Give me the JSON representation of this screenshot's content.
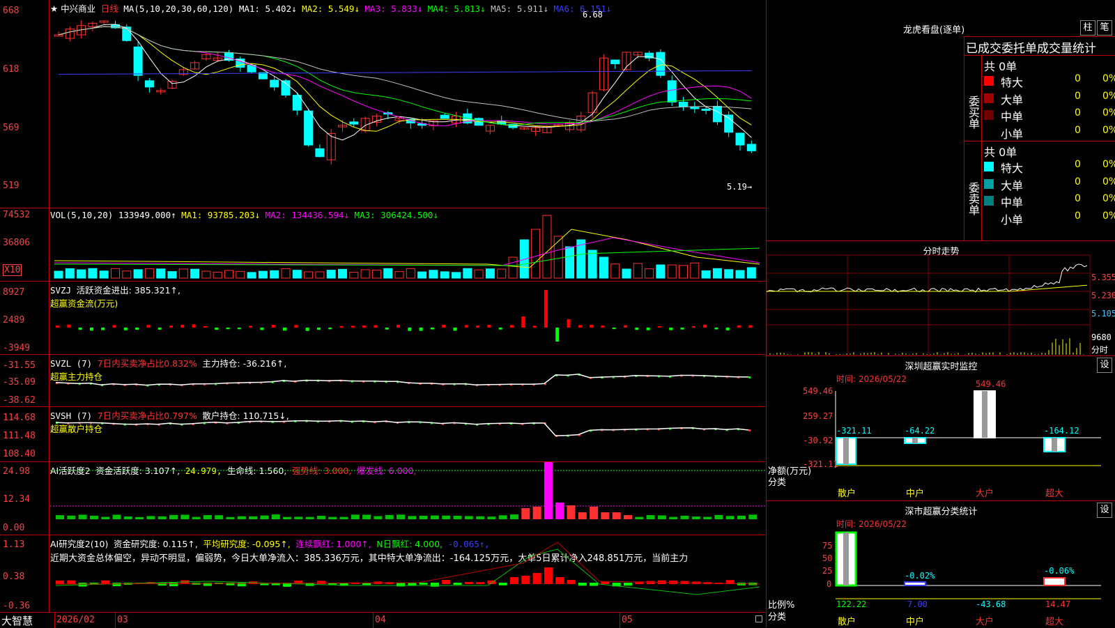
{
  "main_chart": {
    "stock_name": "★ 中兴商业",
    "period": "日线",
    "ma_params": "MA(5,10,20,30,60,120)",
    "ma_values": [
      {
        "label": "MA1: 5.402↓",
        "color": "#ffffff"
      },
      {
        "label": "MA2: 5.549↓",
        "color": "#ffff00"
      },
      {
        "label": "MA3: 5.833↓",
        "color": "#ff00ff"
      },
      {
        "label": "MA4: 5.813↓",
        "color": "#00ff00"
      },
      {
        "label": "MA5: 5.911↓",
        "color": "#c0c0c0"
      },
      {
        "label": "MA6: 6.151↓",
        "color": "#3c3cff"
      }
    ],
    "y_labels": [
      "668",
      "618",
      "569",
      "519"
    ],
    "high_marker": "6.68",
    "low_marker": "5.19→"
  },
  "volume": {
    "title": "VOL(5,10,20)",
    "value": "133949.000↑",
    "ma1": "MA1: 93785.203↓",
    "ma2": "MA2: 134436.594↓",
    "ma3": "MA3: 306424.500↓",
    "y_labels": [
      "74532",
      "36806"
    ],
    "unit": "X10"
  },
  "svzj": {
    "title": "SVZJ",
    "label": "活跃资金进出: 385.321↑,",
    "subtitle": "超赢资金流(万元)",
    "y_labels": [
      "8927",
      "2489",
      "-3949"
    ]
  },
  "svzl": {
    "title": "SVZL (7)",
    "label1": "7日内买卖净占比0.832%",
    "label2": "主力持仓: -36.216↑,",
    "subtitle": "超赢主力持仓",
    "y_labels": [
      "-31.55",
      "-35.09",
      "-38.62"
    ]
  },
  "svsh": {
    "title": "SVSH (7)",
    "label1": "7日内买卖净占比0.797%",
    "label2": "散户持仓: 110.715↓,",
    "subtitle": "超赢散户持仓",
    "y_labels": [
      "114.68",
      "111.48",
      "108.40"
    ]
  },
  "ai_active": {
    "title": "AI活跃度2",
    "v1": "资金活跃度: 3.107↑,",
    "v2": "24.979,",
    "v3": "生命线: 1.560,",
    "v4": "强势线: 3.000,",
    "v5": "爆发线: 6.000,",
    "y_labels": [
      "24.98",
      "12.34",
      "0.00"
    ]
  },
  "ai_research": {
    "title": "AI研究度2(10)",
    "v1": "资金研究度: 0.115↑,",
    "v2": "平均研究度: -0.095↑,",
    "v3": "连续飘红: 1.000↑,",
    "v4": "N日飘红: 4.000,",
    "v5": "-0.065↑,",
    "commentary": "近期大资金总体偏空，异动不明显，偏弱势，今日大单净流入：385.336万元，其中特大单净流出：-164.125万元，大单5日累计净入248.851万元，当前主力",
    "y_labels": [
      "1.13",
      "0.38",
      "-0.36"
    ]
  },
  "bottom_axis": {
    "brand": "大智慧",
    "labels": [
      "2026/02",
      "03",
      "04",
      "05"
    ]
  },
  "lhb": {
    "title": "龙虎看盘(逐单)",
    "btn_zhu": "柱",
    "btn_bi": "笔",
    "subtitle": "已成交委托单成交量统计",
    "buy_label": "委买单",
    "sell_label": "委卖单",
    "buy_total": "共 0单",
    "sell_total": "共 0单",
    "buy_rows": [
      {
        "name": "特大",
        "count": "0",
        "pct": "0%",
        "color": "#ff0000"
      },
      {
        "name": "大单",
        "count": "0",
        "pct": "0%",
        "color": "#a00000"
      },
      {
        "name": "中单",
        "count": "0",
        "pct": "0%",
        "color": "#700000"
      },
      {
        "name": "小单",
        "count": "0",
        "pct": "0%",
        "color": "#000000"
      }
    ],
    "sell_rows": [
      {
        "name": "特大",
        "count": "0",
        "pct": "0%",
        "color": "#00ffff"
      },
      {
        "name": "大单",
        "count": "0",
        "pct": "0%",
        "color": "#00a0a0"
      },
      {
        "name": "中单",
        "count": "0",
        "pct": "0%",
        "color": "#008080"
      },
      {
        "name": "小单",
        "count": "0",
        "pct": "0%",
        "color": "#000000"
      }
    ]
  },
  "intraday": {
    "title": "分时走势",
    "y_labels": [
      "5.355",
      "5.230",
      "5.105",
      "9680"
    ],
    "vol_label": "分时"
  },
  "monitor": {
    "title": "深圳超赢实时监控",
    "btn": "设",
    "time": "时间: 2026/05/22",
    "y_labels": [
      "549.46",
      "259.27",
      "-30.92",
      "-321.11"
    ],
    "net_label": "净额(万元)",
    "cat_label": "分类",
    "categories": [
      "散户",
      "中户",
      "大户",
      "超大"
    ],
    "value_labels": [
      "-321.11",
      "-64.22",
      "549.46",
      "-164.12"
    ]
  },
  "classify": {
    "title": "深市超赢分类统计",
    "btn": "设",
    "time": "时间: 2026/05/22",
    "y_labels": [
      "75",
      "50",
      "25",
      "0"
    ],
    "ratio_label": "比例%",
    "cat_label": "分类",
    "categories": [
      "散户",
      "中户",
      "大户",
      "超大"
    ],
    "values": [
      "122.22",
      "7.00",
      "-43.68",
      "14.47"
    ],
    "bar_labels": [
      "-0.02%",
      "-0.06%"
    ]
  }
}
